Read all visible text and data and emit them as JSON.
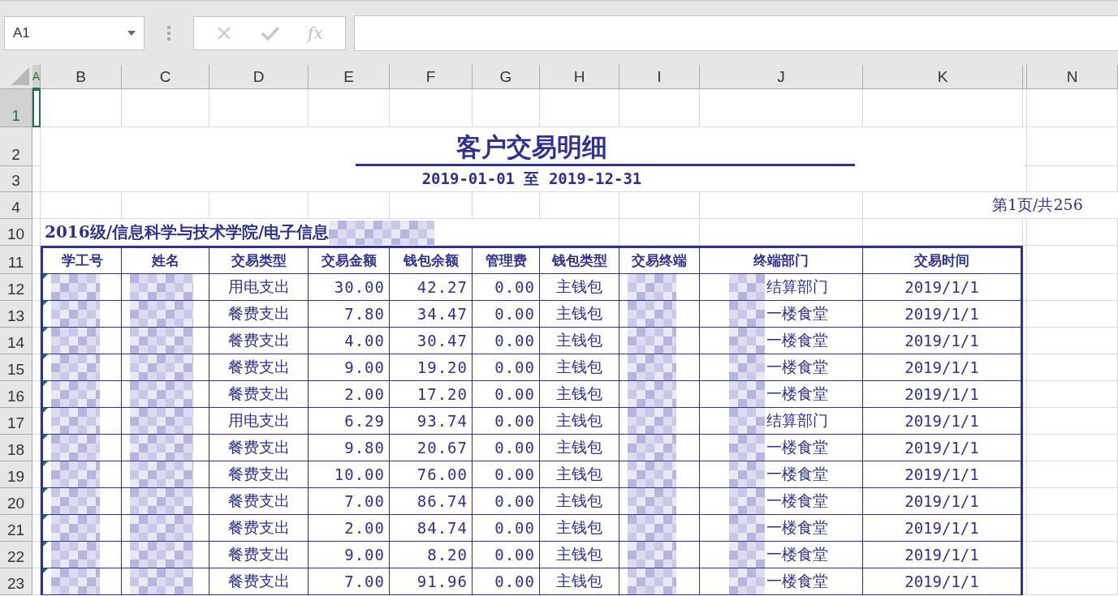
{
  "name_box": "A1",
  "fx_label": "fx",
  "columns": [
    {
      "label": "A",
      "selected": true
    },
    {
      "label": "B",
      "selected": false
    },
    {
      "label": "C",
      "selected": false
    },
    {
      "label": "D",
      "selected": false
    },
    {
      "label": "E",
      "selected": false
    },
    {
      "label": "F",
      "selected": false
    },
    {
      "label": "G",
      "selected": false
    },
    {
      "label": "H",
      "selected": false
    },
    {
      "label": "I",
      "selected": false
    },
    {
      "label": "J",
      "selected": false
    },
    {
      "label": "K",
      "selected": false
    },
    {
      "selected": false
    },
    {
      "label": "N",
      "selected": false
    }
  ],
  "row_numbers": [
    {
      "label": "1",
      "selected": true
    },
    {
      "label": "2",
      "selected": false
    },
    {
      "label": "3",
      "selected": false
    },
    {
      "label": "4",
      "selected": false
    },
    {
      "label": "10",
      "selected": false
    },
    {
      "label": "11",
      "selected": false
    },
    {
      "label": "12",
      "selected": false
    },
    {
      "label": "13",
      "selected": false
    },
    {
      "label": "14",
      "selected": false
    },
    {
      "label": "15",
      "selected": false
    },
    {
      "label": "16",
      "selected": false
    },
    {
      "label": "17",
      "selected": false
    },
    {
      "label": "18",
      "selected": false
    },
    {
      "label": "19",
      "selected": false
    },
    {
      "label": "20",
      "selected": false
    },
    {
      "label": "21",
      "selected": false
    },
    {
      "label": "22",
      "selected": false
    },
    {
      "label": "23",
      "selected": false
    }
  ],
  "report": {
    "title": "客户交易明细",
    "date_range": "2019-01-01 至 2019-12-31",
    "page_info": "第1页/共256",
    "group": "2016级/信息科学与技术学院/电子信息"
  },
  "table": {
    "headers": [
      "学工号",
      "姓名",
      "交易类型",
      "交易金额",
      "钱包余额",
      "管理费",
      "钱包类型",
      "交易终端",
      "终端部门",
      "交易时间"
    ],
    "rows": [
      {
        "flagged": true,
        "type": "用电支出",
        "amount": "30.00",
        "balance": "42.27",
        "fee": "0.00",
        "wallet": "主钱包",
        "dept": "结算部门",
        "time": "2019/1/1"
      },
      {
        "flagged": true,
        "type": "餐费支出",
        "amount": "7.80",
        "balance": "34.47",
        "fee": "0.00",
        "wallet": "主钱包",
        "dept": "一楼食堂",
        "time": "2019/1/1"
      },
      {
        "flagged": true,
        "type": "餐费支出",
        "amount": "4.00",
        "balance": "30.47",
        "fee": "0.00",
        "wallet": "主钱包",
        "dept": "一楼食堂",
        "time": "2019/1/1"
      },
      {
        "flagged": true,
        "type": "餐费支出",
        "amount": "9.00",
        "balance": "19.20",
        "fee": "0.00",
        "wallet": "主钱包",
        "dept": "一楼食堂",
        "time": "2019/1/1"
      },
      {
        "flagged": true,
        "type": "餐费支出",
        "amount": "2.00",
        "balance": "17.20",
        "fee": "0.00",
        "wallet": "主钱包",
        "dept": "一楼食堂",
        "time": "2019/1/1"
      },
      {
        "flagged": true,
        "type": "用电支出",
        "amount": "6.29",
        "balance": "93.74",
        "fee": "0.00",
        "wallet": "主钱包",
        "dept": "结算部门",
        "time": "2019/1/1"
      },
      {
        "flagged": true,
        "type": "餐费支出",
        "amount": "9.80",
        "balance": "20.67",
        "fee": "0.00",
        "wallet": "主钱包",
        "dept": "一楼食堂",
        "time": "2019/1/1"
      },
      {
        "flagged": true,
        "type": "餐费支出",
        "amount": "10.00",
        "balance": "76.00",
        "fee": "0.00",
        "wallet": "主钱包",
        "dept": "一楼食堂",
        "time": "2019/1/1"
      },
      {
        "flagged": true,
        "type": "餐费支出",
        "amount": "7.00",
        "balance": "86.74",
        "fee": "0.00",
        "wallet": "主钱包",
        "dept": "一楼食堂",
        "time": "2019/1/1"
      },
      {
        "flagged": true,
        "type": "餐费支出",
        "amount": "2.00",
        "balance": "84.74",
        "fee": "0.00",
        "wallet": "主钱包",
        "dept": "一楼食堂",
        "time": "2019/1/1"
      },
      {
        "flagged": true,
        "type": "餐费支出",
        "amount": "9.00",
        "balance": "8.20",
        "fee": "0.00",
        "wallet": "主钱包",
        "dept": "一楼食堂",
        "time": "2019/1/1"
      },
      {
        "flagged": true,
        "type": "餐费支出",
        "amount": "7.00",
        "balance": "91.96",
        "fee": "0.00",
        "wallet": "主钱包",
        "dept": "一楼食堂",
        "time": "2019/1/1"
      }
    ]
  }
}
